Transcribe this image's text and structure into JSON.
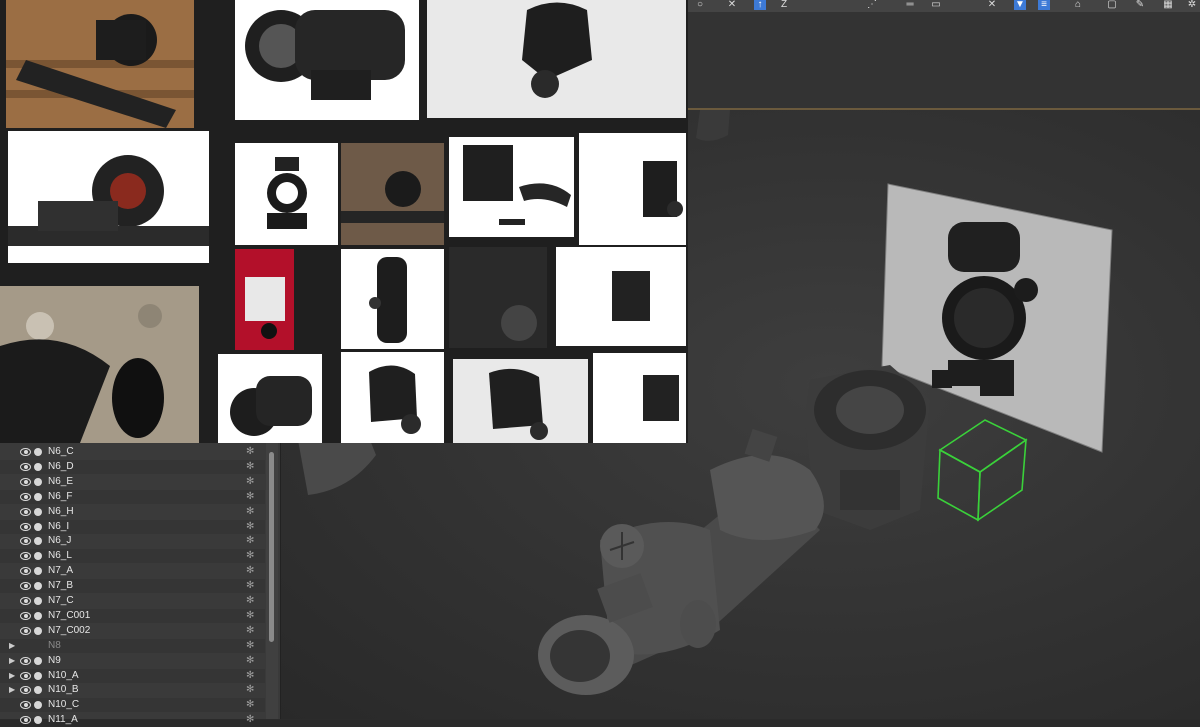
{
  "toolbar": {
    "icons": [
      "link-icon",
      "move-icon",
      "rotate-icon",
      "scale-icon",
      "snap-icon",
      "align-icon",
      "mirror-icon",
      "layer-icon",
      "curve-icon",
      "schematic-icon"
    ]
  },
  "explorer": {
    "rows": [
      {
        "name": "N6_C",
        "expandable": false,
        "visible": true,
        "dim": false
      },
      {
        "name": "N6_D",
        "expandable": false,
        "visible": true,
        "dim": false
      },
      {
        "name": "N6_E",
        "expandable": false,
        "visible": true,
        "dim": false
      },
      {
        "name": "N6_F",
        "expandable": false,
        "visible": true,
        "dim": false
      },
      {
        "name": "N6_H",
        "expandable": false,
        "visible": true,
        "dim": false
      },
      {
        "name": "N6_I",
        "expandable": false,
        "visible": true,
        "dim": false
      },
      {
        "name": "N6_J",
        "expandable": false,
        "visible": true,
        "dim": false
      },
      {
        "name": "N6_L",
        "expandable": false,
        "visible": true,
        "dim": false
      },
      {
        "name": "N7_A",
        "expandable": false,
        "visible": true,
        "dim": false
      },
      {
        "name": "N7_B",
        "expandable": false,
        "visible": true,
        "dim": false
      },
      {
        "name": "N7_C",
        "expandable": false,
        "visible": true,
        "dim": false
      },
      {
        "name": "N7_C001",
        "expandable": false,
        "visible": true,
        "dim": false
      },
      {
        "name": "N7_C002",
        "expandable": false,
        "visible": true,
        "dim": false
      },
      {
        "name": "N8",
        "expandable": true,
        "visible": false,
        "dim": true
      },
      {
        "name": "N9",
        "expandable": true,
        "visible": true,
        "dim": false
      },
      {
        "name": "N10_A",
        "expandable": true,
        "visible": true,
        "dim": false
      },
      {
        "name": "N10_B",
        "expandable": true,
        "visible": true,
        "dim": false
      },
      {
        "name": "N10_C",
        "expandable": false,
        "visible": true,
        "dim": false
      },
      {
        "name": "N11_A",
        "expandable": false,
        "visible": true,
        "dim": false
      }
    ]
  },
  "colors": {
    "selection_wire": "#3ad13a",
    "panel_bg": "#3a3a3a",
    "viewport_bg": "#323232",
    "toolbar_active": "#3d7ad6"
  }
}
